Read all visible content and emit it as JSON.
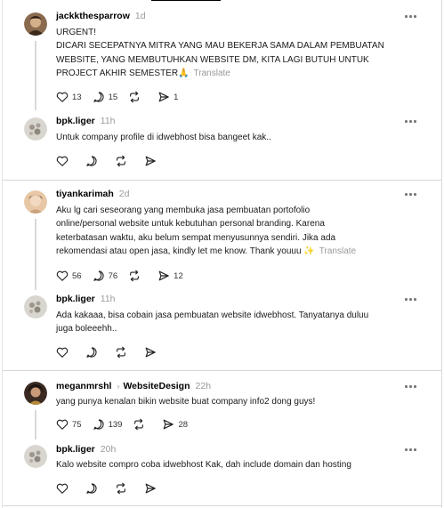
{
  "threads": [
    {
      "post": {
        "username": "jackkthesparrow",
        "time": "1d",
        "lines": [
          "URGENT!",
          "DICARI SECEPATNYA MITRA YANG MAU BEKERJA SAMA DALAM PEMBUATAN",
          "WEBSITE, YANG MEMBUTUHKAN WEBSITE DM, KITA LAGI BUTUH UNTUK",
          "PROJECT AKHIR SEMESTER🙏"
        ],
        "translate": "Translate",
        "likes": "13",
        "replies": "15",
        "shares": "1"
      },
      "reply": {
        "username": "bpk.liger",
        "time": "11h",
        "lines": [
          "Untuk company profile di idwebhost bisa bangeet kak.."
        ]
      }
    },
    {
      "post": {
        "username": "tiyankarimah",
        "time": "2d",
        "lines": [
          "Aku lg cari seseorang yang membuka jasa pembuatan portofolio",
          "online/personal website untuk kebutuhan personal branding. Karena",
          "keterbatasan waktu, aku belum sempat menyusunnya sendiri. Jika ada",
          "rekomendasi atau open jasa, kindly let me know. Thank youuu ✨"
        ],
        "translate": "Translate",
        "likes": "56",
        "replies": "76",
        "shares": "12"
      },
      "reply": {
        "username": "bpk.liger",
        "time": "11h",
        "lines": [
          "Ada kakaaa, bisa cobain jasa pembuatan website idwebhost. Tanyatanya duluu",
          "juga boleeehh.."
        ]
      }
    },
    {
      "post": {
        "username": "meganmrshl",
        "topic": "WebsiteDesign",
        "time": "22h",
        "lines": [
          "yang punya kenalan bikin website buat company info2 dong guys!"
        ],
        "likes": "75",
        "replies": "139",
        "shares": "28"
      },
      "reply": {
        "username": "bpk.liger",
        "time": "20h",
        "lines": [
          "Kalo website compro coba idwebhost Kak, dah include domain dan hosting"
        ]
      }
    }
  ],
  "icons": {
    "like": "heart-icon",
    "reply": "comment-icon",
    "repost": "repost-icon",
    "share": "share-icon",
    "more": "more-dots-icon",
    "topic_separator": "chevron-right-icon"
  },
  "colors": {
    "text": "#000000",
    "muted": "#999999",
    "divider": "#d6d6d6",
    "thread_line": "#d9d9d9"
  }
}
